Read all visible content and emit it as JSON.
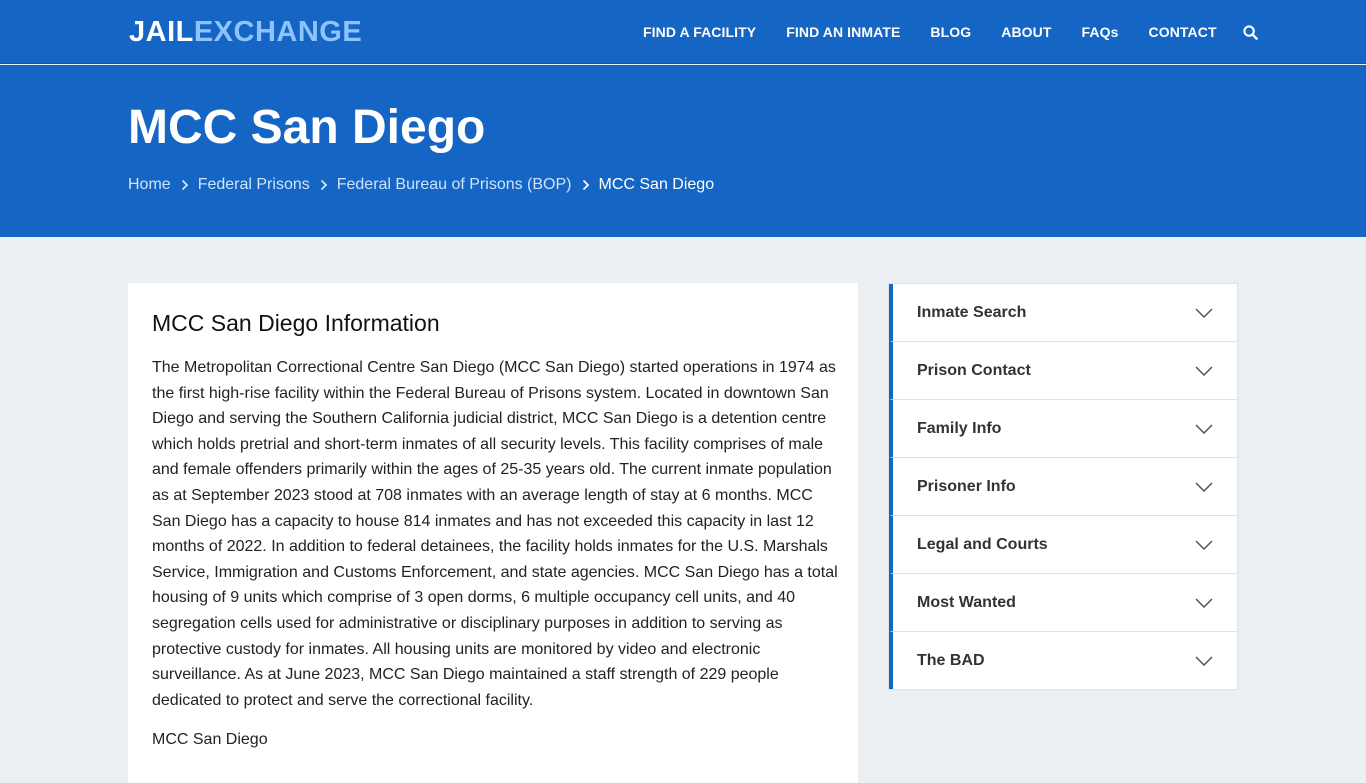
{
  "brand": {
    "part1": "JAIL",
    "part2": "EXCHANGE"
  },
  "nav": {
    "items": [
      "FIND A FACILITY",
      "FIND AN INMATE",
      "BLOG",
      "ABOUT",
      "FAQs",
      "CONTACT"
    ],
    "search_icon": "search-icon"
  },
  "hero": {
    "title": "MCC San Diego",
    "breadcrumb": [
      "Home",
      "Federal Prisons",
      "Federal Bureau of Prisons (BOP)",
      "MCC San Diego"
    ]
  },
  "main": {
    "heading": "MCC San Diego Information",
    "body": "The Metropolitan Correctional Centre San Diego (MCC San Diego) started operations in 1974 as the first high-rise facility within the Federal Bureau of Prisons system. Located in downtown San Diego and serving the Southern California judicial district, MCC San Diego is a detention centre which holds pretrial and short-term inmates of all security levels. This facility comprises of male and female offenders primarily within the ages of 25-35 years old. The current inmate population as at September 2023 stood at 708 inmates with an average length of stay at 6 months. MCC San Diego has a capacity to house 814 inmates and has not exceeded this capacity in last 12 months of 2022. In addition to federal detainees, the facility holds inmates for the U.S. Marshals Service, Immigration and Customs Enforcement, and state agencies. MCC San Diego has a total housing of 9 units which comprise of 3 open dorms, 6 multiple occupancy cell units, and 40 segregation cells used for administrative or disciplinary purposes in addition to serving as protective custody for inmates. All housing units are monitored by video and electronic surveillance. As at June 2023, MCC San Diego maintained a staff strength of 229 people dedicated to protect and serve the correctional facility.",
    "footer_text": "MCC San Diego"
  },
  "sidebar": {
    "items": [
      "Inmate Search",
      "Prison Contact",
      "Family Info",
      "Prisoner Info",
      "Legal and Courts",
      "Most Wanted",
      "The BAD"
    ]
  },
  "colors": {
    "primary": "#1565c5",
    "logo_accent": "#8fc3ff",
    "page_bg": "#eceff2"
  }
}
